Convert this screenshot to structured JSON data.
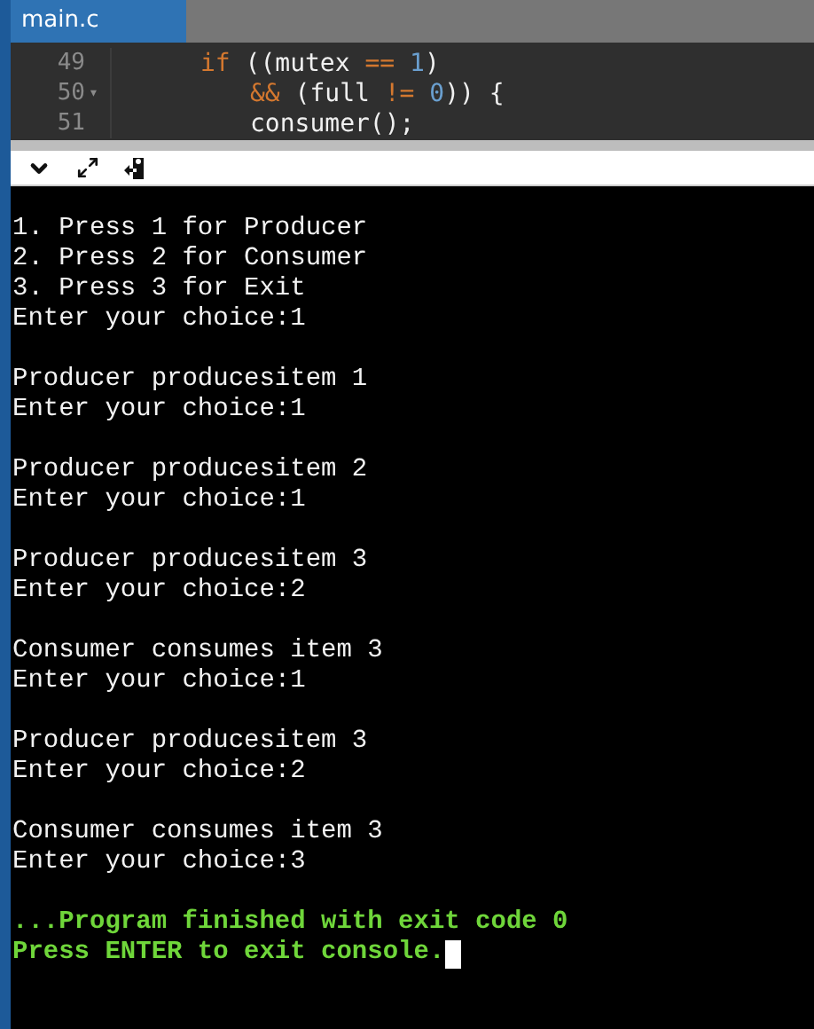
{
  "tabs": [
    {
      "label": "main.c",
      "selected": true
    }
  ],
  "editor": {
    "lines": [
      {
        "number": "49",
        "tokens": [
          {
            "kind": "keyword",
            "text": "if"
          },
          {
            "kind": "plain",
            "text": " ((mutex "
          },
          {
            "kind": "operator",
            "text": "== "
          },
          {
            "kind": "number",
            "text": "1"
          },
          {
            "kind": "plain",
            "text": ")"
          }
        ],
        "children": [
          {
            "number": "50",
            "fold_marker": "▾",
            "tokens": [
              {
                "kind": "operator",
                "text": "&&"
              },
              {
                "kind": "plain",
                "text": " (full "
              },
              {
                "kind": "operator",
                "text": "!= "
              },
              {
                "kind": "number",
                "text": "0"
              },
              {
                "kind": "plain",
                "text": ")) {"
              }
            ]
          },
          {
            "number": "51",
            "tokens": [
              {
                "kind": "plain",
                "text": "consumer();"
              }
            ]
          }
        ]
      }
    ]
  },
  "console": {
    "blocks": [
      {
        "kind": "output",
        "lines": [
          "1. Press 1 for Producer",
          "2. Press 2 for Consumer",
          "3. Press 3 for Exit",
          "Enter your choice:1"
        ]
      },
      {
        "kind": "output",
        "lines": [
          "Producer producesitem 1",
          "Enter your choice:1"
        ]
      },
      {
        "kind": "output",
        "lines": [
          "Producer producesitem 2",
          "Enter your choice:1"
        ]
      },
      {
        "kind": "output",
        "lines": [
          "Producer producesitem 3",
          "Enter your choice:2"
        ]
      },
      {
        "kind": "output",
        "lines": [
          "Consumer consumes item 3",
          "Enter your choice:1"
        ]
      },
      {
        "kind": "output",
        "lines": [
          "Producer producesitem 3",
          "Enter your choice:2"
        ]
      },
      {
        "kind": "output",
        "lines": [
          "Consumer consumes item 3",
          "Enter your choice:3"
        ]
      },
      {
        "kind": "status",
        "lines": [
          "...Program finished with exit code 0",
          "Press ENTER to exit console."
        ]
      }
    ],
    "cursor": true
  }
}
